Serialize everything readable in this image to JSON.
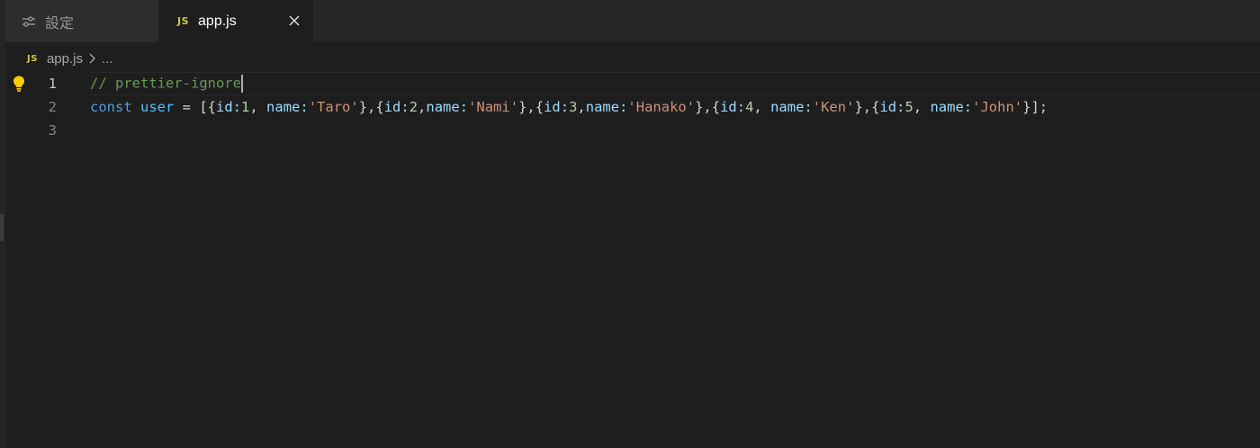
{
  "tabs": [
    {
      "label": "設定",
      "icon": "settings-sliders-icon"
    },
    {
      "label": "app.js",
      "icon": "js-file-icon",
      "badge": "JS",
      "active": true
    }
  ],
  "breadcrumb": {
    "badge": "JS",
    "file": "app.js",
    "more": "..."
  },
  "editor": {
    "line_numbers": [
      "1",
      "2",
      "3"
    ],
    "active_line": 1,
    "line1": {
      "comment": "// prettier-ignore"
    },
    "line2": {
      "const": "const",
      "var": "user",
      "eq": " = ",
      "open": "[{",
      "items": [
        {
          "id": "1",
          "name": "'Taro'"
        },
        {
          "id": "2",
          "name": "'Nami'"
        },
        {
          "id": "3",
          "name": "'Hanako'"
        },
        {
          "id": "4",
          "name": "'Ken'"
        },
        {
          "id": "5",
          "name": "'John'"
        }
      ],
      "close": "}];"
    }
  },
  "colors": {
    "background": "#1e1e1e",
    "comment": "#6a9955",
    "keyword": "#569cd6",
    "property": "#9cdcfe",
    "number": "#b5cea8",
    "string": "#ce9178",
    "js_badge": "#cbcb41",
    "lightbulb": "#ffcc00"
  }
}
